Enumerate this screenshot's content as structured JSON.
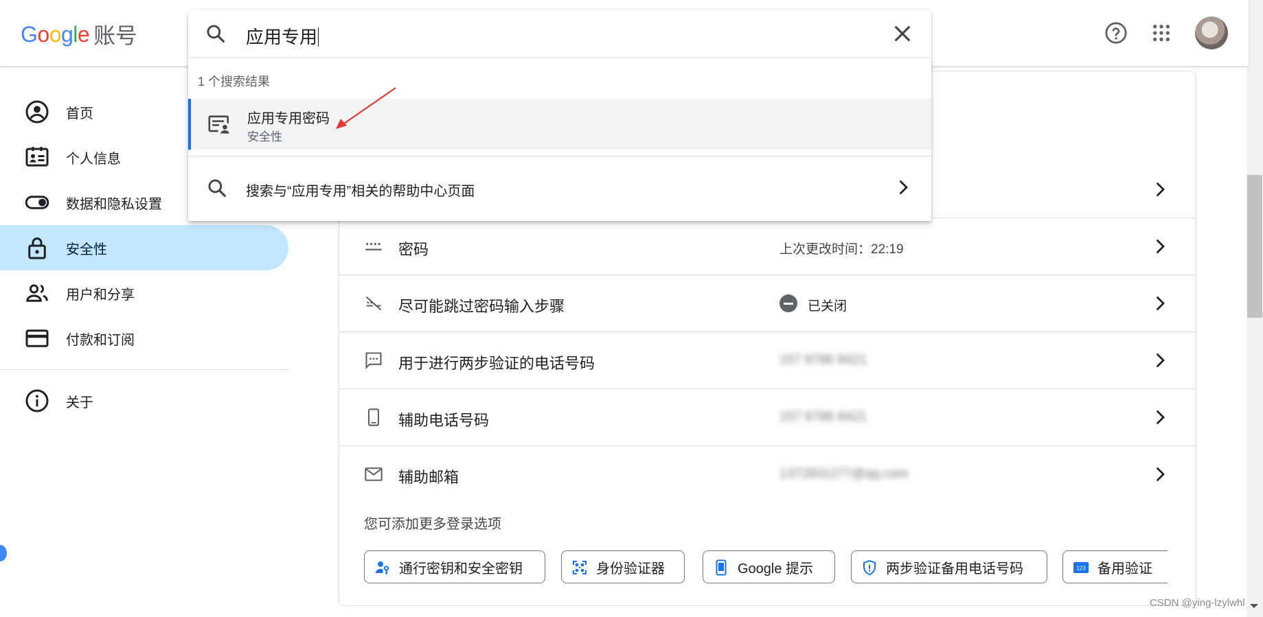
{
  "header": {
    "logo_text": "Google",
    "logo_suffix": "账号",
    "help_icon": "help-circle-icon",
    "apps_icon": "apps-grid-icon"
  },
  "search": {
    "query": "应用专用",
    "result_count": "1 个搜索结果",
    "result": {
      "title": "应用专用密码",
      "subtitle": "安全性",
      "icon": "password-card-icon"
    },
    "help_text": "搜索与“应用专用”相关的帮助中心页面"
  },
  "sidebar": {
    "items": [
      {
        "label": "首页",
        "icon": "account-circle-icon"
      },
      {
        "label": "个人信息",
        "icon": "id-card-icon"
      },
      {
        "label": "数据和隐私设置",
        "icon": "toggle-icon"
      },
      {
        "label": "安全性",
        "icon": "lock-icon",
        "active": true
      },
      {
        "label": "用户和分享",
        "icon": "people-icon"
      },
      {
        "label": "付款和订阅",
        "icon": "credit-card-icon"
      }
    ],
    "about": {
      "label": "关于",
      "icon": "info-icon"
    }
  },
  "security": {
    "rows": [
      {
        "label": "密码",
        "value": "上次更改时间：22:19",
        "icon": "password-dots-icon"
      },
      {
        "label": "尽可能跳过密码输入步骤",
        "value": "已关闭",
        "icon": "passkey-off-icon"
      },
      {
        "label": "用于进行两步验证的电话号码",
        "value": "157 6786 8421",
        "icon": "sms-icon"
      },
      {
        "label": "辅助电话号码",
        "value": "157 6786 8421",
        "icon": "phone-icon"
      },
      {
        "label": "辅助邮箱",
        "value": "1372831277@qq.com",
        "icon": "mail-icon"
      }
    ],
    "more_label": "您可添加更多登录选项",
    "chips": [
      {
        "label": "通行密钥和安全密钥",
        "icon": "passkey-person-icon"
      },
      {
        "label": "身份验证器",
        "icon": "qr-code-icon"
      },
      {
        "label": "Google 提示",
        "icon": "phone-prompt-icon"
      },
      {
        "label": "两步验证备用电话号码",
        "icon": "shield-icon"
      },
      {
        "label": "备用验证",
        "icon": "backup-codes-icon"
      }
    ]
  },
  "watermark": "CSDN @ying-lzylwhl",
  "colors": {
    "active_nav_bg": "#c2e7ff",
    "accent": "#1a73e8",
    "annotation_arrow": "#e53935"
  }
}
